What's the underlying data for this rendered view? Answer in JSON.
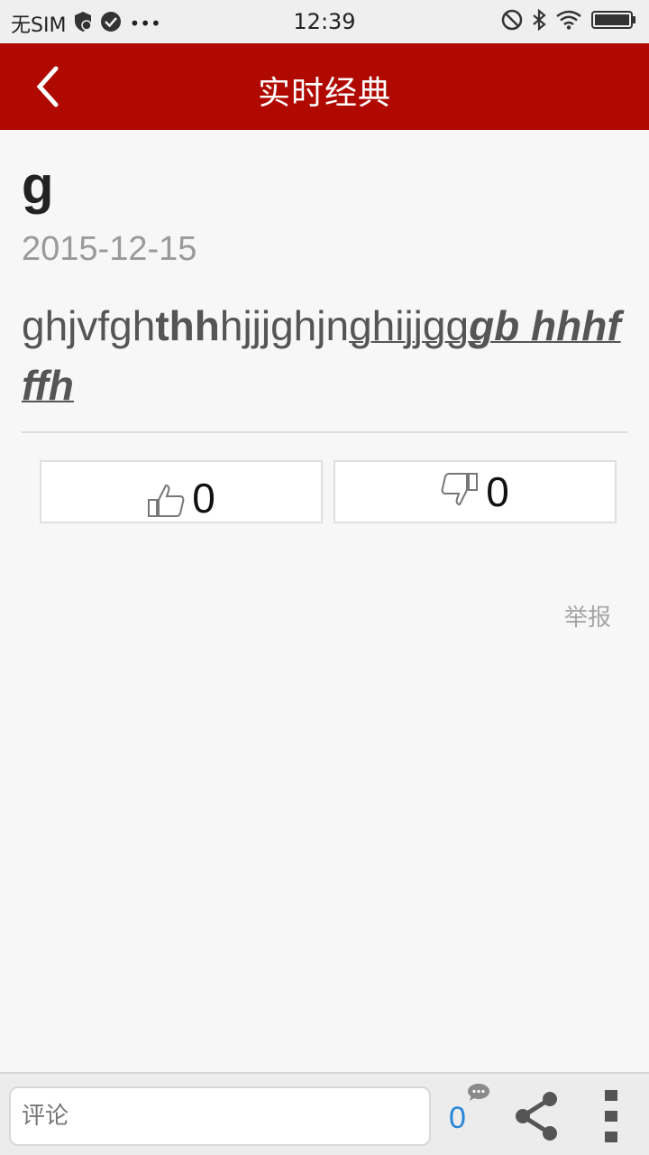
{
  "status_bar": {
    "carrier": "无SIM",
    "time": "12:39",
    "more": "•••"
  },
  "header": {
    "title": "实时经典",
    "back_icon": "chevron-left-icon"
  },
  "article": {
    "title": "g",
    "date": "2015-12-15",
    "body": {
      "seg1": "ghjvfgh",
      "seg2": "thh",
      "seg3": "hjjjghjn",
      "seg4": "ghijjgg",
      "seg5": "gb hhhfffh"
    }
  },
  "votes": {
    "like_count": "0",
    "dislike_count": "0",
    "like_icon": "thumbs-up-icon",
    "dislike_icon": "thumbs-down-icon"
  },
  "report_label": "举报",
  "bottom_bar": {
    "comment_placeholder": "评论",
    "comment_count": "0",
    "share_icon": "share-icon",
    "more_icon": "more-vertical-icon"
  },
  "colors": {
    "header_bg": "#b00a00",
    "accent_blue": "#2a86d8"
  }
}
